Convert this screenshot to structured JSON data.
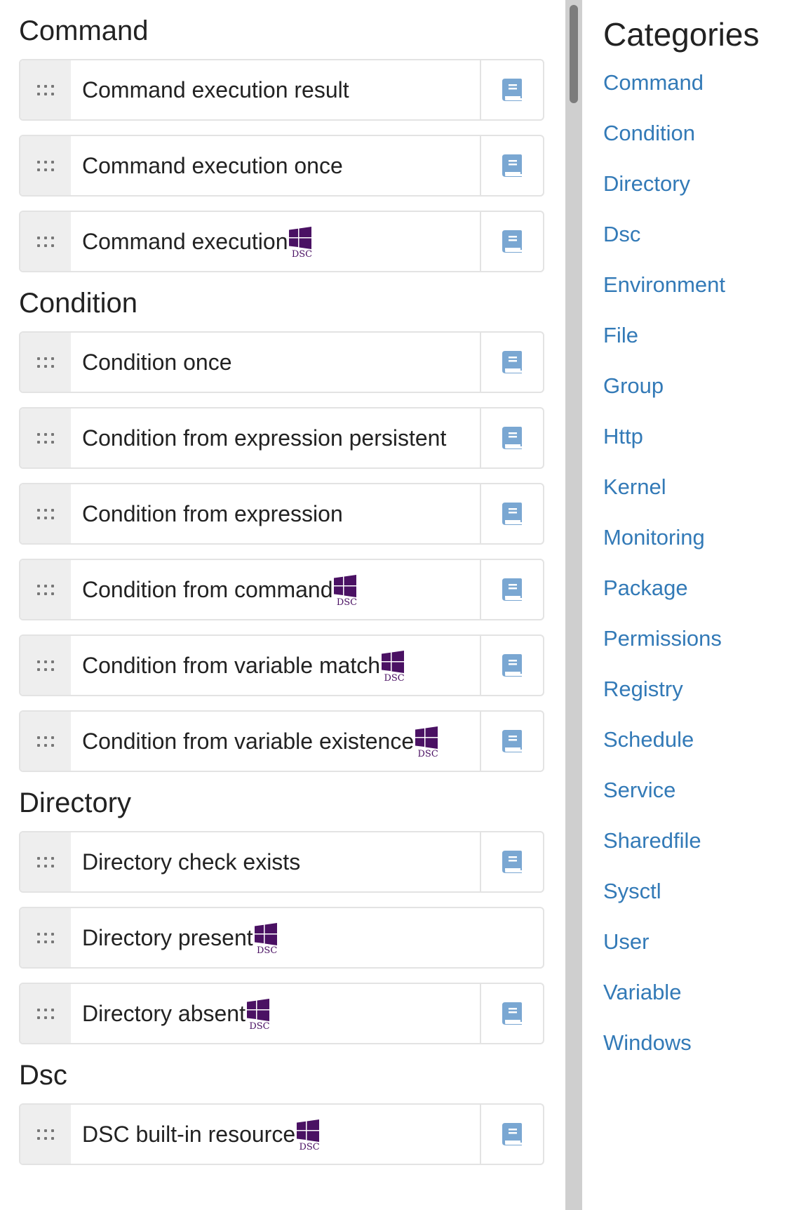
{
  "sections": [
    {
      "title": "Command",
      "items": [
        {
          "label": "Command execution result",
          "dsc": false,
          "doc": true
        },
        {
          "label": "Command execution once",
          "dsc": false,
          "doc": true
        },
        {
          "label": "Command execution",
          "dsc": true,
          "doc": true
        }
      ]
    },
    {
      "title": "Condition",
      "items": [
        {
          "label": "Condition once",
          "dsc": false,
          "doc": true
        },
        {
          "label": "Condition from expression persistent",
          "dsc": false,
          "doc": true
        },
        {
          "label": "Condition from expression",
          "dsc": false,
          "doc": true
        },
        {
          "label": "Condition from command",
          "dsc": true,
          "doc": true
        },
        {
          "label": "Condition from variable match",
          "dsc": true,
          "doc": true
        },
        {
          "label": "Condition from variable existence",
          "dsc": true,
          "doc": true
        }
      ]
    },
    {
      "title": "Directory",
      "items": [
        {
          "label": "Directory check exists",
          "dsc": false,
          "doc": true
        },
        {
          "label": "Directory present",
          "dsc": true,
          "doc": false
        },
        {
          "label": "Directory absent",
          "dsc": true,
          "doc": true
        }
      ]
    },
    {
      "title": "Dsc",
      "items": [
        {
          "label": "DSC built-in resource",
          "dsc": true,
          "doc": true
        }
      ]
    }
  ],
  "dsc_badge_text": "DSC",
  "colors": {
    "dsc_logo": "#4a1163",
    "doc_icon": "#7aa7d2",
    "link": "#337ab7"
  },
  "sidebar": {
    "title": "Categories",
    "links": [
      "Command",
      "Condition",
      "Directory",
      "Dsc",
      "Environment",
      "File",
      "Group",
      "Http",
      "Kernel",
      "Monitoring",
      "Package",
      "Permissions",
      "Registry",
      "Schedule",
      "Service",
      "Sharedfile",
      "Sysctl",
      "User",
      "Variable",
      "Windows"
    ]
  }
}
